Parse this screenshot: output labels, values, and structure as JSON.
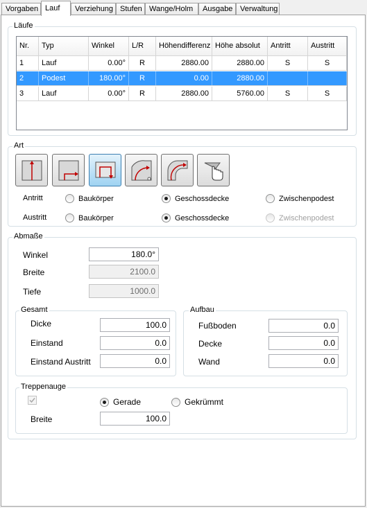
{
  "tabs": [
    "Vorgaben",
    "Lauf",
    "Verziehung",
    "Stufen",
    "Wange/Holm",
    "Ausgabe",
    "Verwaltung"
  ],
  "laeufe": {
    "legend": "Läufe",
    "columns": [
      "Nr.",
      "Typ",
      "Winkel",
      "L/R",
      "Höhendifferenz",
      "Höhe absolut",
      "Antritt",
      "Austritt"
    ],
    "rows": [
      [
        "1",
        "Lauf",
        "0.00°",
        "R",
        "2880.00",
        "2880.00",
        "S",
        "S"
      ],
      [
        "2",
        "Podest",
        "180.00°",
        "R",
        "0.00",
        "2880.00",
        "",
        ""
      ],
      [
        "3",
        "Lauf",
        "0.00°",
        "R",
        "2880.00",
        "5760.00",
        "S",
        "S"
      ]
    ],
    "selected_row": 1
  },
  "art": {
    "legend": "Art",
    "buttons": [
      "straight-flight-icon",
      "quarter-landing-icon",
      "half-landing-icon",
      "winder-quarter-icon",
      "winder-curved-icon",
      "hand-pointer-icon"
    ],
    "selected_button": 2,
    "antritt": {
      "label": "Antritt",
      "options": [
        "Baukörper",
        "Geschossdecke",
        "Zwischenpodest"
      ],
      "selected": 1
    },
    "austritt": {
      "label": "Austritt",
      "options": [
        "Baukörper",
        "Geschossdecke",
        "Zwischenpodest"
      ],
      "selected": 1,
      "disabled": [
        2
      ]
    }
  },
  "abmasse": {
    "legend": "Abmaße",
    "winkel_label": "Winkel",
    "winkel_value": "180.0°",
    "breite_label": "Breite",
    "breite_value": "2100.0",
    "tiefe_label": "Tiefe",
    "tiefe_value": "1000.0"
  },
  "gesamt": {
    "legend": "Gesamt",
    "dicke_label": "Dicke",
    "dicke_value": "100.0",
    "einstand_label": "Einstand",
    "einstand_value": "0.0",
    "einstand_austritt_label": "Einstand Austritt",
    "einstand_austritt_value": "0.0"
  },
  "aufbau": {
    "legend": "Aufbau",
    "fussboden_label": "Fußboden",
    "fussboden_value": "0.0",
    "decke_label": "Decke",
    "decke_value": "0.0",
    "wand_label": "Wand",
    "wand_value": "0.0"
  },
  "treppenauge": {
    "legend": "Treppenauge",
    "gerade_label": "Gerade",
    "gekruemmt_label": "Gekrümmt",
    "selected": "Gerade",
    "checkbox_checked": true,
    "checkbox_disabled": true,
    "breite_label": "Breite",
    "breite_value": "100.0"
  },
  "colors": {
    "selection": "#3399ff",
    "accent_red": "#c00000",
    "group_border": "#d5dfe5"
  }
}
